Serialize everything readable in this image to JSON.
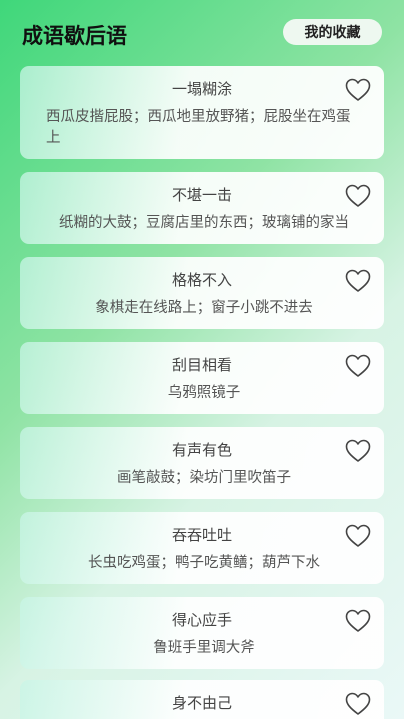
{
  "header": {
    "title": "成语歇后语",
    "favorites_label": "我的收藏"
  },
  "items": [
    {
      "title": "一塌糊涂",
      "text": "西瓜皮揩屁股；西瓜地里放野猪；屁股坐在鸡蛋上"
    },
    {
      "title": "不堪一击",
      "text": "纸糊的大鼓；豆腐店里的东西；玻璃铺的家当"
    },
    {
      "title": "格格不入",
      "text": "象棋走在线路上；窗子小跳不进去"
    },
    {
      "title": "刮目相看",
      "text": "乌鸦照镜子"
    },
    {
      "title": "有声有色",
      "text": "画笔敲鼓；染坊门里吹笛子"
    },
    {
      "title": "吞吞吐吐",
      "text": "长虫吃鸡蛋；鸭子吃黄鳝；葫芦下水"
    },
    {
      "title": "得心应手",
      "text": "鲁班手里调大斧"
    },
    {
      "title": "身不由己",
      "text": ""
    }
  ],
  "icons": {
    "favorite": "heart-outline-icon"
  }
}
